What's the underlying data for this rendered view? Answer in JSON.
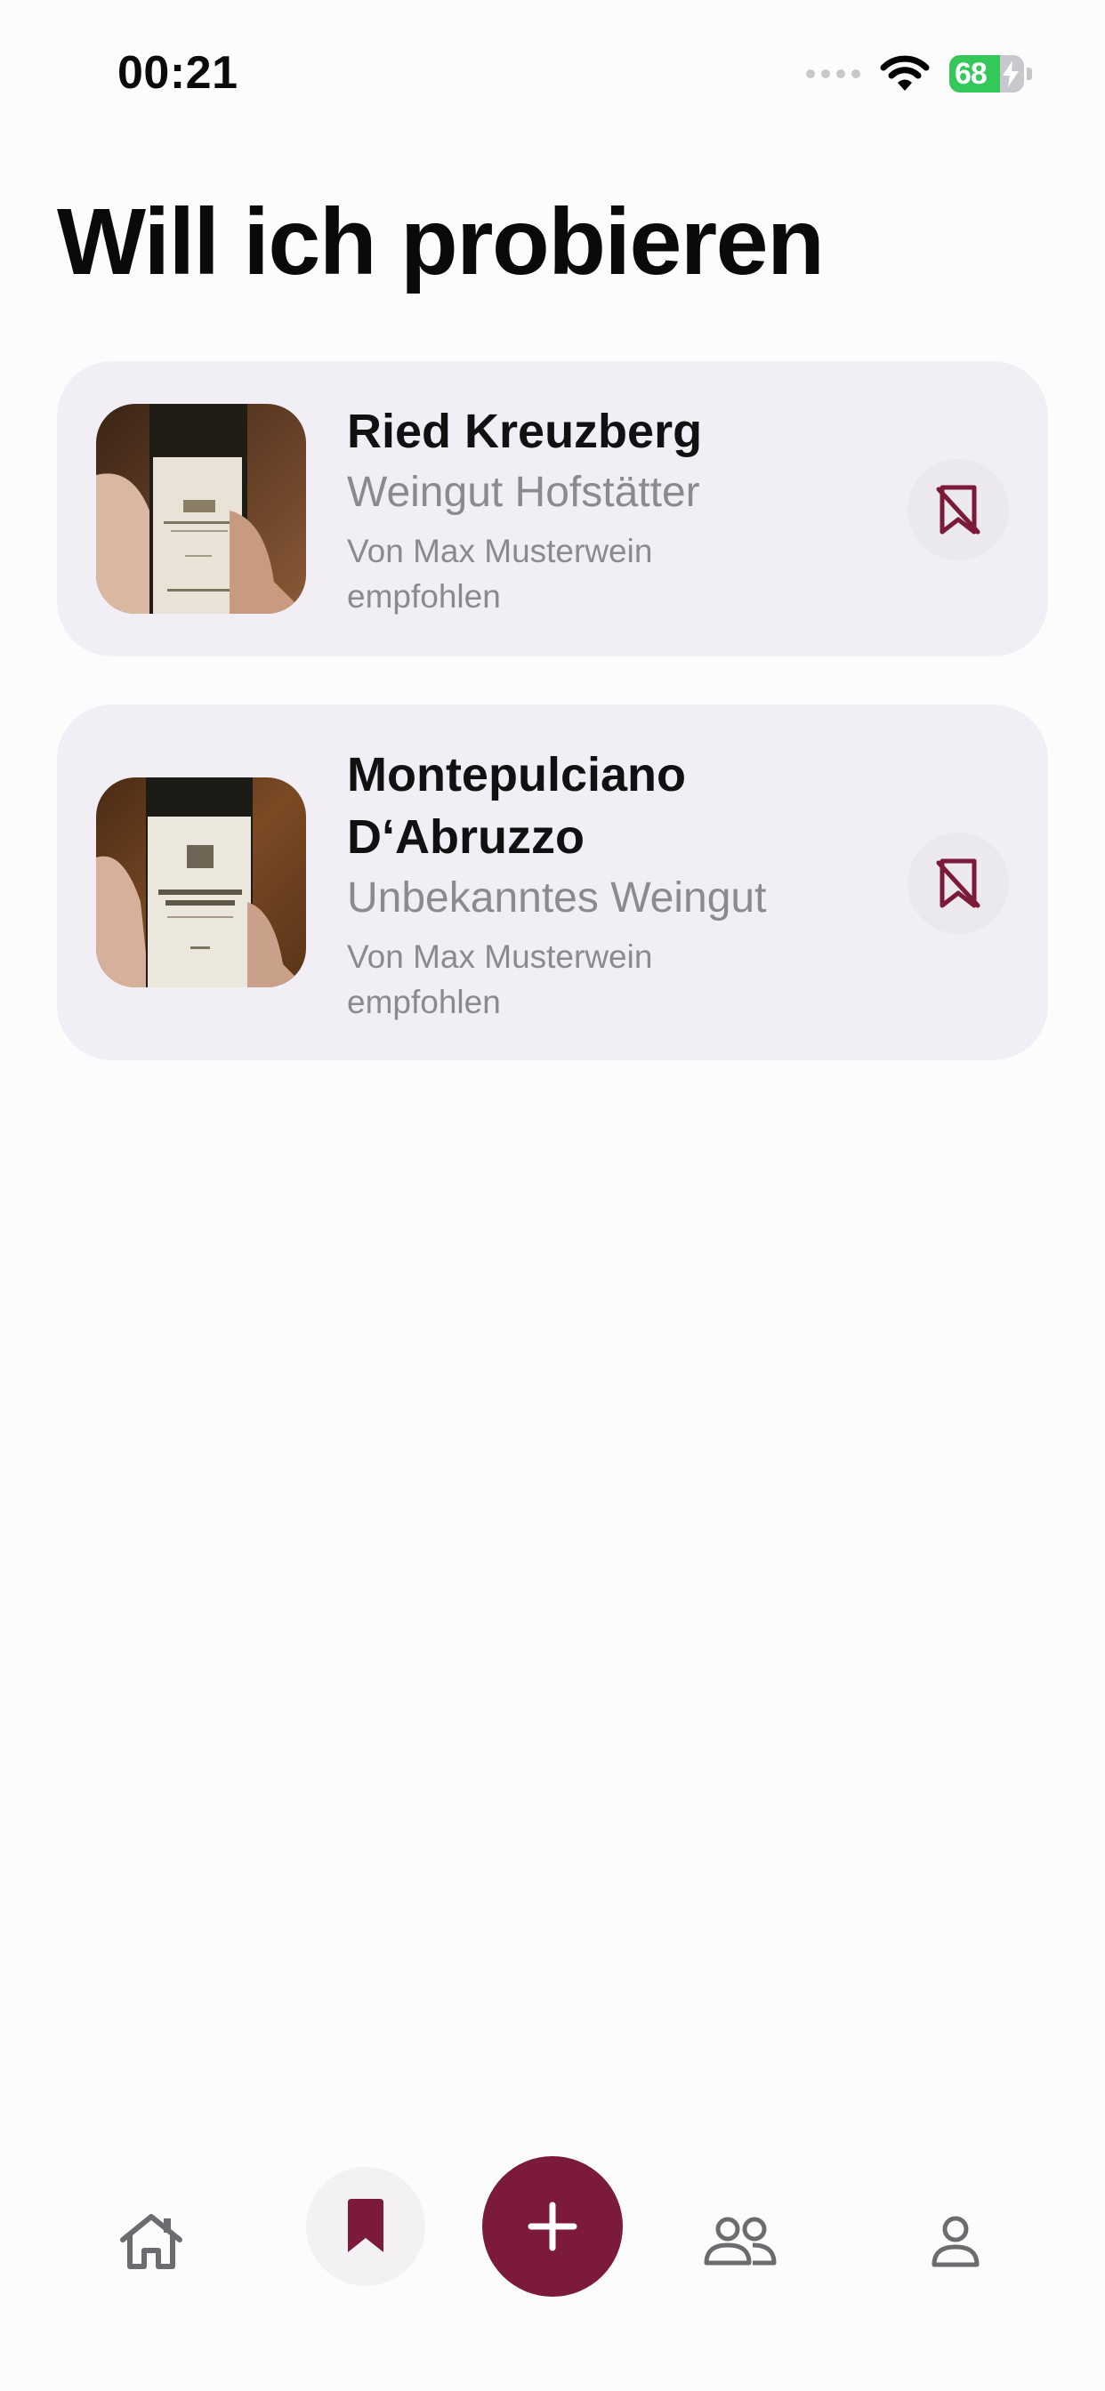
{
  "status_bar": {
    "time": "00:21",
    "battery_level": "68",
    "battery_fill_fraction": 0.68,
    "icons": [
      "signal-dots-icon",
      "wifi-icon",
      "battery-charging-icon"
    ]
  },
  "page": {
    "title": "Will ich probieren"
  },
  "wishlist": [
    {
      "name": "Ried Kreuzberg",
      "winery": "Weingut Hofstätter",
      "recommended_by": "Von Max Musterwein empfohlen",
      "action_icon": "bookmark-slash-icon"
    },
    {
      "name": "Montepulciano D‘Abruzzo",
      "winery": "Unbekanntes Weingut",
      "recommended_by": "Von Max Musterwein empfohlen",
      "action_icon": "bookmark-slash-icon"
    }
  ],
  "tab_bar": {
    "active_tab": "saved",
    "accent_color": "#7c1a3a",
    "tabs": [
      "home-icon",
      "bookmark-icon",
      "plus-icon",
      "people-icon",
      "person-icon"
    ]
  },
  "colors": {
    "accent": "#7c1a3a",
    "card_background": "#f1eff5",
    "secondary_text": "#8b8a90",
    "battery_green": "#34c759"
  }
}
